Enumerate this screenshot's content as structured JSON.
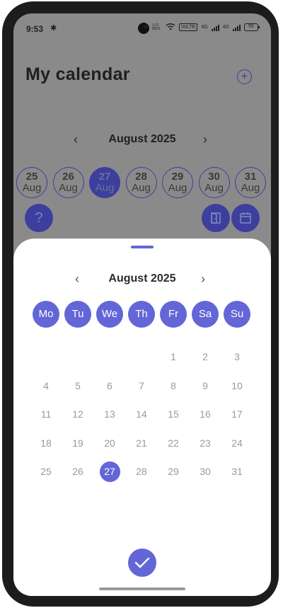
{
  "status_bar": {
    "time": "9:53",
    "net_speed": "3.21 KB/S",
    "volte": "VoLTE",
    "sim1": "4G",
    "sim2": "4G",
    "battery": "55"
  },
  "header": {
    "title": "My calendar",
    "add_icon": "plus-circle-icon"
  },
  "background_month": {
    "label": "August 2025",
    "prev": "‹",
    "next": "›"
  },
  "day_strip": [
    {
      "day": "25",
      "month": "Aug",
      "selected": false
    },
    {
      "day": "26",
      "month": "Aug",
      "selected": false
    },
    {
      "day": "27",
      "month": "Aug",
      "selected": true
    },
    {
      "day": "28",
      "month": "Aug",
      "selected": false
    },
    {
      "day": "29",
      "month": "Aug",
      "selected": false
    },
    {
      "day": "30",
      "month": "Aug",
      "selected": false
    },
    {
      "day": "31",
      "month": "Aug",
      "selected": false
    }
  ],
  "help_button": {
    "label": "?"
  },
  "date_picker": {
    "month_label": "August 2025",
    "prev": "‹",
    "next": "›",
    "weekdays": [
      "Mo",
      "Tu",
      "We",
      "Th",
      "Fr",
      "Sa",
      "Su"
    ],
    "first_weekday_index": 4,
    "days_in_month": 31,
    "selected_day": 27
  },
  "colors": {
    "accent": "#6366d6",
    "accent_dark": "#3d3f9e",
    "muted_day": "#9a9a9a",
    "scrim": "#8a8a8a"
  }
}
